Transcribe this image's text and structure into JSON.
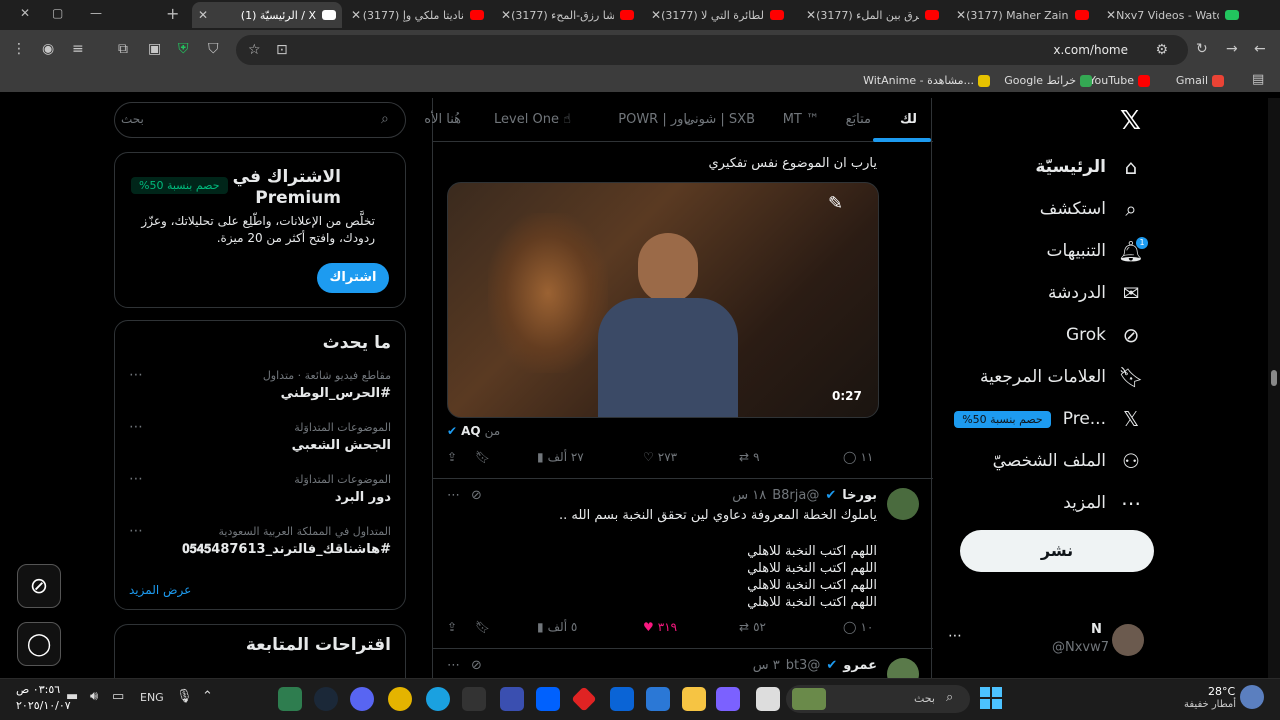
{
  "browser": {
    "tabs": [
      {
        "title": "Nxv7 Videos - Watch",
        "color": "#22c55e"
      },
      {
        "title": "(3177) Maher Zain &",
        "color": "#ff0000"
      },
      {
        "title": "(3177) الفرق بين الملء",
        "color": "#ff0000"
      },
      {
        "title": "(3177) الطائرة التي لا",
        "color": "#ff0000"
      },
      {
        "title": "(3177) رشا رزق-المحء",
        "color": "#ff0000"
      },
      {
        "title": "(3177) ناديتا ملكي وإ",
        "color": "#ff0000"
      },
      {
        "title": "(1) الرئيسيّة / X",
        "color": "#ffffff",
        "active": true
      }
    ],
    "url": "x.com/home",
    "bookmarks": [
      {
        "label": "Gmail",
        "color": "#ea4335"
      },
      {
        "label": "YouTube",
        "color": "#ff0000"
      },
      {
        "label": "Google خرائط",
        "color": "#34a853"
      },
      {
        "label": "WitAnime - مشاهدة...",
        "color": "#e6c200"
      }
    ]
  },
  "nav": {
    "items": [
      {
        "label": "الرئيسيّة",
        "icon": "home-icon",
        "glyph": "⌂"
      },
      {
        "label": "استكشف",
        "icon": "search-icon",
        "glyph": "⌕"
      },
      {
        "label": "التنبيهات",
        "icon": "bell-icon",
        "glyph": "🔔︎",
        "badge": "1"
      },
      {
        "label": "الدردشة",
        "icon": "mail-icon",
        "glyph": "✉"
      },
      {
        "label": "Grok",
        "icon": "grok-icon",
        "glyph": "⊘"
      },
      {
        "label": "العلامات المرجعية",
        "icon": "bookmark-icon",
        "glyph": "🔖︎"
      },
      {
        "label": "Pre...",
        "icon": "x-logo-icon",
        "glyph": "𝕏",
        "pill": "%حصم بنسبة 50"
      },
      {
        "label": "الملف الشخصيّ",
        "icon": "profile-icon",
        "glyph": "⚇"
      },
      {
        "label": "المزيد",
        "icon": "more-icon",
        "glyph": "⋯"
      }
    ],
    "post_label": "نشر",
    "account_name": "N",
    "account_handle": "@Nxvw7"
  },
  "feed": {
    "tabs": [
      "لك",
      "متابَع",
      "MT ™",
      "شونی | SXB",
      "POWR | باور",
      "Level One ☝",
      "هُنا الأه"
    ],
    "tweet1": {
      "text": "يارب ان الموضوع نفس تفكيري",
      "video_duration": "0:27",
      "source_prefix": "من",
      "source_name": "AQ",
      "replies": "١١",
      "retweets": "٩",
      "likes": "٢٧٣",
      "views": "٢٧ ألف"
    },
    "tweet2": {
      "name": "بورخا",
      "handle": "@B8rja",
      "time": "١٨ س",
      "line1": "ياملوك الخطة المعروفة دعاوي لين تحقق النخبة بسم الله ..",
      "lines": [
        "اللهم اكتب النخبة للاهلي",
        "اللهم اكتب النخبة للاهلي",
        "اللهم اكتب النخبة للاهلي",
        "اللهم اكتب النخبة للاهلي"
      ],
      "replies": "١٠",
      "retweets": "٥٢",
      "likes": "٣١٩",
      "views": "٥ ألف"
    },
    "tweet3": {
      "name": "عمرو",
      "handle": "@bt3",
      "time": "٣ س"
    }
  },
  "sidebar": {
    "search_placeholder": "بحث",
    "premium": {
      "title": "الاشتراك في Premium",
      "badge": "%حصم بنسبة 50",
      "body": "تخلَّص من الإعلانات، واطّلِع على تحليلاتك، وعزّز ردودك، وافتح أكثر من 20 ميزة.",
      "button": "اشتراك"
    },
    "trends": {
      "title": "ما يحدث",
      "items": [
        {
          "context": "مقاطع فيديو شائعة · متداول",
          "name": "#الحرس_الوطني"
        },
        {
          "context": "الموضوعات المتداوَلة",
          "name": "الجحش الشعبي"
        },
        {
          "context": "الموضوعات المتداوَلة",
          "name": "دور البرد"
        },
        {
          "context": "المتداول في المملكة العربية السعودية",
          "name": "#هاشناقك_فالترند_487613‏𝟎𝟓𝟒𝟓"
        }
      ],
      "show_more": "عرض المزيد"
    },
    "follow_title": "اقتراحات المتابعة"
  },
  "taskbar": {
    "weather_temp": "28°C",
    "weather_desc": "أمطار خفيفة",
    "search_label": "بحث",
    "lang": "ENG",
    "time": "٠٣:٥٦ ص",
    "date": "٢٠٢٥/١٠/٠٧"
  }
}
